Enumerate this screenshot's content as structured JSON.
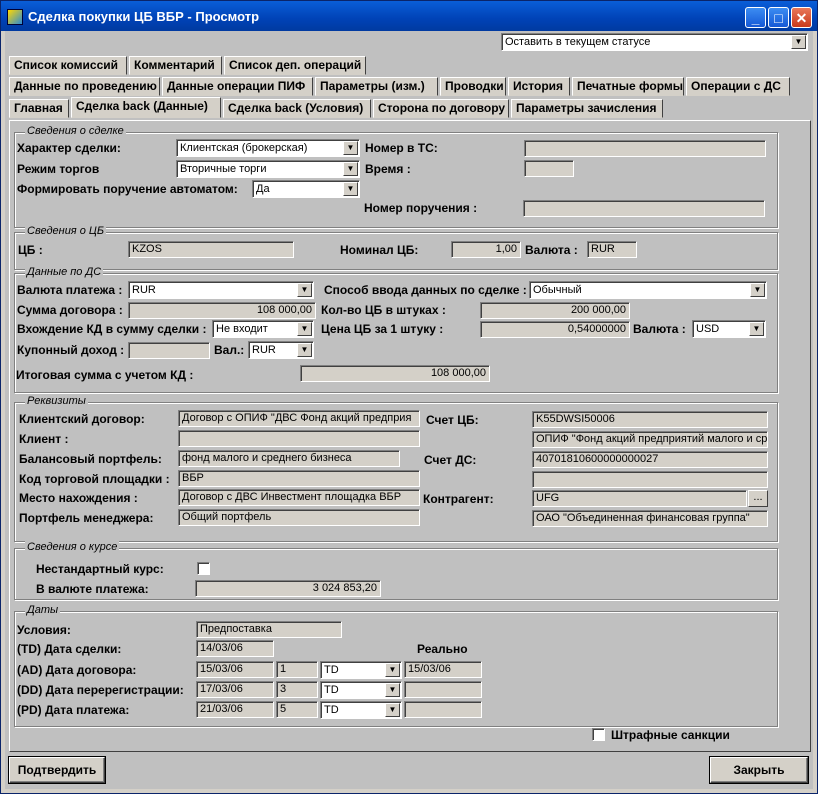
{
  "window": {
    "title": "Сделка покупки ЦБ ВБР - Просмотр",
    "min": "_",
    "max": "□",
    "close": "✕"
  },
  "status_combo": "Оставить в текущем статусе",
  "tabs_row1": [
    "Список комиссий",
    "Комментарий",
    "Список деп. операций"
  ],
  "tabs_row2": [
    "Данные по проведению",
    "Данные операции ПИФ",
    "Параметры (изм.)",
    "Проводки",
    "История",
    "Печатные формы",
    "Операции с ДС"
  ],
  "tabs_row3": [
    "Главная",
    "Сделка back (Данные)",
    "Сделка back (Условия)",
    "Сторона по договору",
    "Параметры зачисления"
  ],
  "deal": {
    "group": "Сведения о сделке",
    "character_label": "Характер сделки:",
    "character_value": "Клиентская (брокерская)",
    "mode_label": "Режим торгов",
    "mode_value": "Вторичные торги",
    "auto_label": "Формировать поручение автоматом:",
    "auto_value": "Да",
    "ts_label": "Номер в ТС:",
    "ts_value": "",
    "time_label": "Время :",
    "time_value": "",
    "order_label": "Номер поручения :",
    "order_value": ""
  },
  "sec": {
    "group": "Сведения о ЦБ",
    "cb_label": "ЦБ :",
    "cb_value": "KZOS",
    "nominal_label": "Номинал ЦБ:",
    "nominal_value": "1,00",
    "currency_label": "Валюта :",
    "currency_value": "RUR"
  },
  "ds": {
    "group": "Данные по ДС",
    "pay_cur_label": "Валюта платежа :",
    "pay_cur_value": "RUR",
    "input_method_label": "Способ ввода данных по сделке :",
    "input_method_value": "Обычный",
    "sum_label": "Сумма договора :",
    "sum_value": "108 000,00",
    "qty_label": "Кол-во ЦБ в штуках :",
    "qty_value": "200 000,00",
    "kd_label": "Вхождение КД в сумму сделки :",
    "kd_value": "Не входит",
    "price_label": "Цена ЦБ за 1 штуку :",
    "price_value": "0,54000000",
    "price_cur_label": "Валюта :",
    "price_cur_value": "USD",
    "coupon_label": "Купонный доход :",
    "coupon_value": "",
    "coupon_cur_label": "Вал.:",
    "coupon_cur_value": "RUR",
    "total_label": "Итоговая сумма с учетом КД :",
    "total_value": "108 000,00"
  },
  "req": {
    "group": "Реквизиты",
    "contract_label": "Клиентский договор:",
    "contract_value": "Договор с ОПИФ \"ДВС Фонд акций предприя",
    "client_label": "Клиент :",
    "client_value": "",
    "portfolio_label": "Балансовый портфель:",
    "portfolio_value": "фонд малого и среднего бизнеса",
    "venue_label": "Код торговой площадки :",
    "venue_value": "ВБР",
    "place_label": "Место нахождения :",
    "place_value": "Договор с ДВС Инвестмент площадка ВБР",
    "mgr_label": "Портфель менеджера:",
    "mgr_value": "Общий портфель",
    "cb_acc_label": "Счет ЦБ:",
    "cb_acc_value": "K55DWSI50006",
    "cb_acc_name": "ОПИФ \"Фонд акций предприятий малого и ср",
    "ds_acc_label": "Счет ДС:",
    "ds_acc_value": "40701810600000000027",
    "ds_acc_name": "",
    "contr_label": "Контрагент:",
    "contr_value": "UFG",
    "contr_btn": "...",
    "contr_name": "ОАО \"Объединенная финансовая группа\""
  },
  "rate": {
    "group": "Сведения о курсе",
    "nonstd_label": "Нестандартный курс:",
    "in_cur_label": "В валюте платежа:",
    "in_cur_value": "3 024 853,20"
  },
  "dates": {
    "group": "Даты",
    "cond_label": "Условия:",
    "cond_value": "Предпоставка",
    "real_label": "Реально",
    "td_label": "(TD) Дата сделки:",
    "td_value": "14/03/06",
    "ad_label": "(AD) Дата договора:",
    "ad_value": "15/03/06",
    "ad_n": "1",
    "ad_type": "TD",
    "ad_real": "15/03/06",
    "dd_label": "(DD) Дата перерегистрации:",
    "dd_value": "17/03/06",
    "dd_n": "3",
    "dd_type": "TD",
    "dd_real": "",
    "pd_label": "(PD) Дата платежа:",
    "pd_value": "21/03/06",
    "pd_n": "5",
    "pd_type": "TD",
    "pd_real": ""
  },
  "penalty_label": "Штрафные санкции",
  "confirm_btn": "Подтвердить",
  "close_btn": "Закрыть"
}
